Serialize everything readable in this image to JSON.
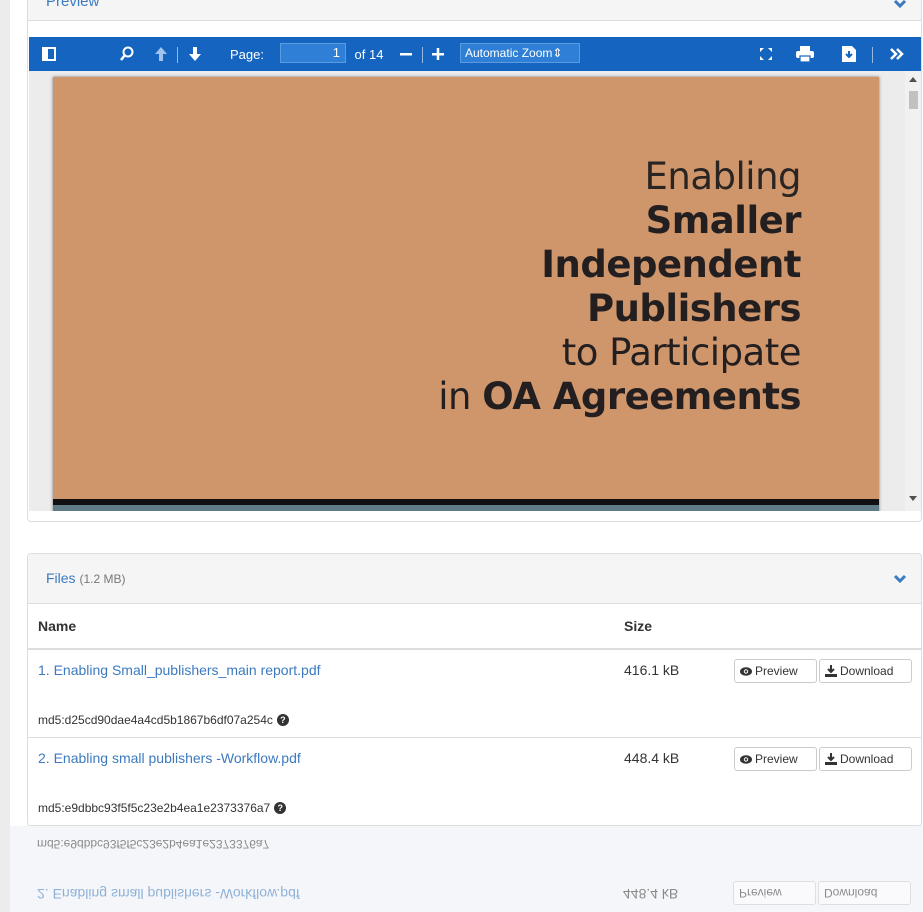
{
  "preview": {
    "title": "Preview",
    "toolbar": {
      "page_label": "Page:",
      "page_value": "1",
      "page_total": "of 14",
      "zoom_value": "Automatic Zoom"
    },
    "document": {
      "line1": "Enabling",
      "line2": "Smaller",
      "line3": "Independent",
      "line4": "Publishers",
      "line5": "to Participate",
      "line6_prefix": "in ",
      "line6_bold": "OA Agreements"
    }
  },
  "files": {
    "title": "Files",
    "size_total": "(1.2 MB)",
    "columns": {
      "name": "Name",
      "size": "Size"
    },
    "rows": [
      {
        "name": "1. Enabling Small_publishers_main report.pdf",
        "size": "416.1 kB",
        "md5": "md5:d25cd90dae4a4cd5b1867b6df07a254c",
        "preview_label": "Preview",
        "download_label": "Download"
      },
      {
        "name": "2. Enabling small publishers -Workflow.pdf",
        "size": "448.4 kB",
        "md5": "md5:e9dbbc93f5f5c23e2b4ea1e2373376a7",
        "preview_label": "Preview",
        "download_label": "Download"
      }
    ]
  },
  "colors": {
    "toolbar": "#1565c0",
    "link": "#3c7abf",
    "cover": "#cf956b"
  }
}
